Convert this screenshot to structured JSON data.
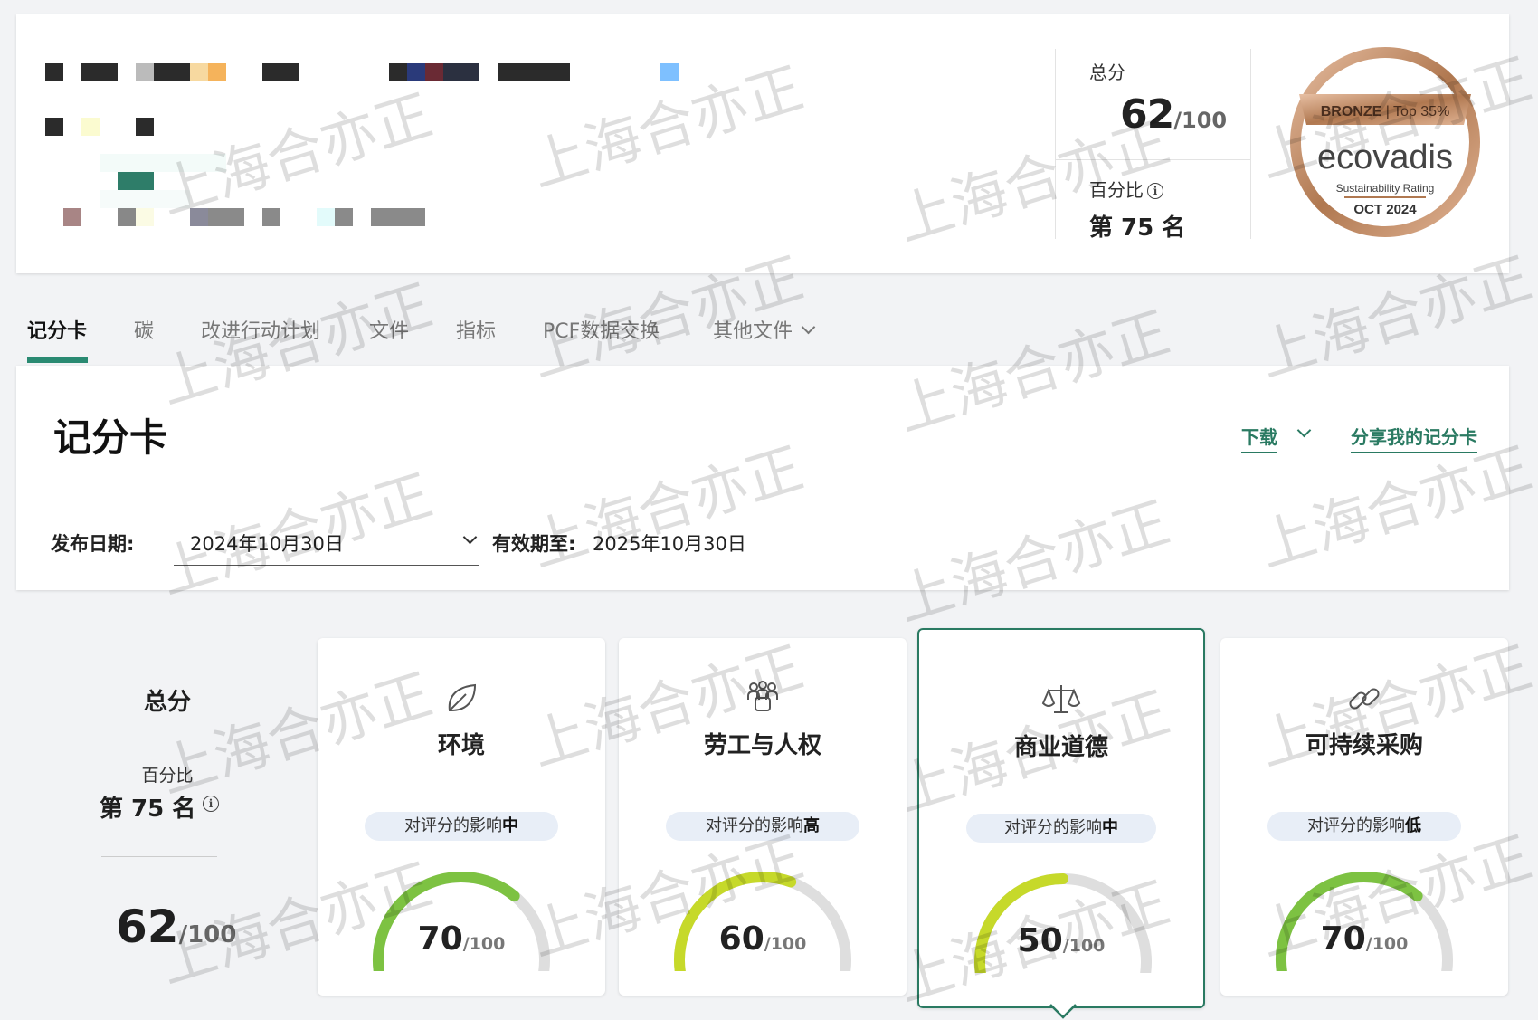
{
  "header": {
    "total_label": "总分",
    "total_score": "62",
    "total_denominator": "/100",
    "percentile_label": "百分比",
    "percentile_rank": "第 75 名",
    "info_glyph": "i"
  },
  "medal": {
    "badge_level": "BRONZE",
    "badge_top": "Top 35%",
    "brand": "ecovadis",
    "subtitle": "Sustainability Rating",
    "date": "OCT 2024"
  },
  "tabs": [
    {
      "label": "记分卡",
      "active": true
    },
    {
      "label": "碳"
    },
    {
      "label": "改进行动计划"
    },
    {
      "label": "文件"
    },
    {
      "label": "指标"
    },
    {
      "label": "PCF数据交换"
    },
    {
      "label": "其他文件"
    }
  ],
  "scorecard": {
    "title": "记分卡",
    "download_label": "下载",
    "share_label": "分享我的记分卡",
    "publish_date_label": "发布日期:",
    "publish_date_value": "2024年10月30日",
    "valid_until_label": "有效期至:",
    "valid_until_value": "2025年10月30日"
  },
  "overall": {
    "title": "总分",
    "percentile_label": "百分比",
    "rank": "第 75 名",
    "score": "62",
    "denominator": "/100"
  },
  "themes": [
    {
      "name": "环境",
      "impact_prefix": "对评分的影响",
      "impact": "中",
      "score": "70",
      "denominator": "/100",
      "value": 70,
      "icon": "leaf-icon",
      "color": "#7dc242"
    },
    {
      "name": "劳工与人权",
      "impact_prefix": "对评分的影响",
      "impact": "高",
      "score": "60",
      "denominator": "/100",
      "value": 60,
      "icon": "people-icon",
      "color": "#c6d92a"
    },
    {
      "name": "商业道德",
      "impact_prefix": "对评分的影响",
      "impact": "中",
      "score": "50",
      "denominator": "/100",
      "value": 50,
      "icon": "scales-icon",
      "color": "#c6d92a"
    },
    {
      "name": "可持续采购",
      "impact_prefix": "对评分的影响",
      "impact": "低",
      "score": "70",
      "denominator": "/100",
      "value": 70,
      "icon": "chain-link-icon",
      "color": "#7dc242"
    }
  ],
  "watermark": "上海合亦正",
  "colors": {
    "accent": "#2a7a62",
    "track": "#dedede"
  }
}
